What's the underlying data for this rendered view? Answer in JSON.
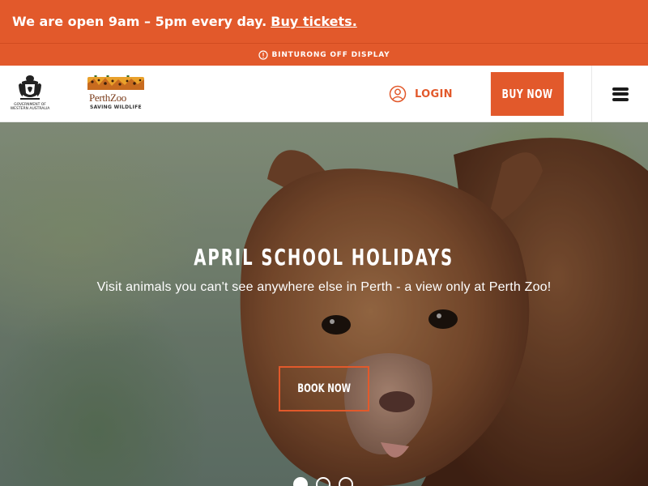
{
  "banner": {
    "text": "We are open 9am – 5pm every day.",
    "link_label": "Buy tickets."
  },
  "alert": {
    "icon": "info-icon",
    "text": "BINTURONG OFF DISPLAY"
  },
  "header": {
    "gov_logo_text": "GOVERNMENT OF WESTERN AUSTRALIA",
    "zoo_logo_name": "PerthZoo",
    "zoo_logo_tagline": "SAVING WILDLIFE",
    "login_label": "LOGIN",
    "buy_label": "BUY NOW",
    "menu_icon": "hamburger-menu-icon"
  },
  "hero": {
    "title": "APRIL SCHOOL HOLIDAYS",
    "subtitle": "Visit animals you can't see anywhere else in Perth - a view only at Perth Zoo!",
    "button_label": "BOOK NOW",
    "slides_count": 3,
    "active_slide": 1
  },
  "colors": {
    "accent": "#e2592b",
    "text_dark": "#1c1c1c",
    "white": "#ffffff"
  }
}
